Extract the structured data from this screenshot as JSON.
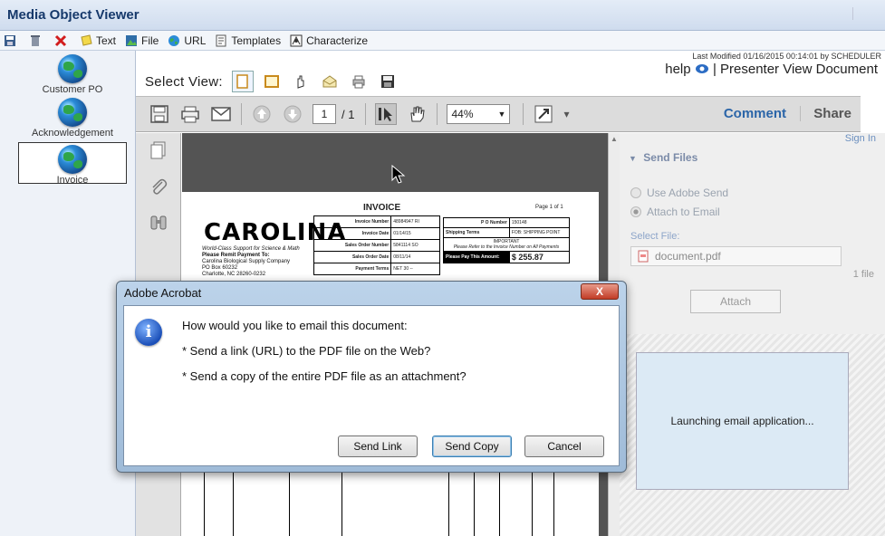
{
  "app": {
    "title": "Media Object Viewer"
  },
  "menubar": {
    "items": [
      {
        "label": "Text",
        "icon": "sticky-note-icon"
      },
      {
        "label": "File",
        "icon": "file-image-icon"
      },
      {
        "label": "URL",
        "icon": "globe-icon"
      },
      {
        "label": "Templates",
        "icon": "template-icon"
      },
      {
        "label": "Characterize",
        "icon": "characterize-icon"
      }
    ]
  },
  "objects": [
    {
      "label": "Customer PO"
    },
    {
      "label": "Acknowledgement"
    },
    {
      "label": "Invoice",
      "selected": true
    }
  ],
  "main": {
    "last_modified": "Last Modified 01/16/2015 00:14:01 by SCHEDULER",
    "select_view_label": "Select View:",
    "right_links": {
      "help": "help",
      "sep": "|",
      "presenter": "Presenter View Document"
    }
  },
  "acrobat": {
    "page_current": "1",
    "page_total": "/ 1",
    "zoom": "44%",
    "comment": "Comment",
    "share": "Share"
  },
  "invoice": {
    "title": "INVOICE",
    "page": "Page 1 of 1",
    "logo": "CAROLINA",
    "address": [
      "World-Class Support for Science & Math",
      "Please Remit Payment To:",
      "Carolina Biological Supply Company",
      "PO Box 60232",
      "Charlotte, NC 28260-0232"
    ],
    "rows": [
      [
        "Invoice Number",
        "48984947 RI"
      ],
      [
        "Invoice Date",
        "01/14/15"
      ],
      [
        "Sales Order Number",
        "5841114 SO"
      ],
      [
        "Sales Order Date",
        "08/11/14"
      ],
      [
        "Payment Terms",
        "NET 30 --"
      ]
    ],
    "po_label": "P O Number",
    "po_value": "150148",
    "ship_label": "Shipping Terms",
    "ship_value": "FOB: SHIPPING POINT",
    "important": "IMPORTANT",
    "important_note": "Please Refer to the Invoice Number on All Payments",
    "pay_label": "Please Pay This Amount:",
    "amount": "$ 255.87"
  },
  "send_panel": {
    "sign_in": "Sign In",
    "header": "Send Files",
    "opt_adobe": "Use Adobe Send",
    "opt_email": "Attach to Email",
    "select_file": "Select File:",
    "file_name": "document.pdf",
    "file_count": "1 file",
    "attach": "Attach",
    "launching": "Launching email application..."
  },
  "dialog": {
    "title": "Adobe Acrobat",
    "close": "X",
    "question": "How would you like to email this document:",
    "option1": "* Send a link (URL) to the PDF file on the Web?",
    "option2": "* Send a copy of the entire PDF file as an attachment?",
    "btn_link": "Send Link",
    "btn_copy": "Send Copy",
    "btn_cancel": "Cancel"
  }
}
